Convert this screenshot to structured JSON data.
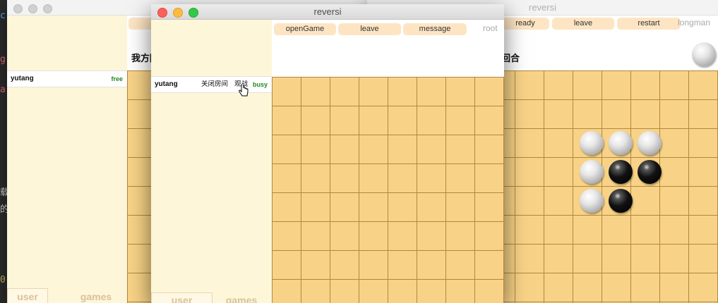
{
  "background_editor": {
    "chars": [
      "c",
      "g",
      "a",
      "载,",
      "的",
      "0"
    ]
  },
  "left_window": {
    "user_row": {
      "name": "yutang",
      "status": "free"
    },
    "tabs": {
      "user": "user",
      "games": "games"
    },
    "turn_label": "我方回合"
  },
  "right_window": {
    "title": "reversi",
    "buttons": {
      "ready": "ready",
      "leave": "leave",
      "restart": "restart"
    },
    "username": "longman",
    "turn_label": "对方回合",
    "current_stone": "white",
    "stones": [
      {
        "row": 2,
        "col": 2,
        "color": "white"
      },
      {
        "row": 2,
        "col": 3,
        "color": "white"
      },
      {
        "row": 2,
        "col": 4,
        "color": "white"
      },
      {
        "row": 3,
        "col": 2,
        "color": "white"
      },
      {
        "row": 3,
        "col": 3,
        "color": "black"
      },
      {
        "row": 3,
        "col": 4,
        "color": "black"
      },
      {
        "row": 4,
        "col": 2,
        "color": "white"
      },
      {
        "row": 4,
        "col": 3,
        "color": "black"
      }
    ]
  },
  "front_window": {
    "title": "reversi",
    "buttons": {
      "open_game": "openGame",
      "leave": "leave",
      "message": "message"
    },
    "username": "root",
    "user_row": {
      "name": "yutang",
      "close_room": "关闭房间",
      "watch": "观战",
      "status": "busy"
    },
    "tabs": {
      "user": "user",
      "games": "games"
    }
  },
  "colors": {
    "board": "#f8d387",
    "grid": "#b0883e",
    "sidebar": "#fef6d8",
    "button": "#fde5c4",
    "status_green": "#1f8a1f"
  }
}
